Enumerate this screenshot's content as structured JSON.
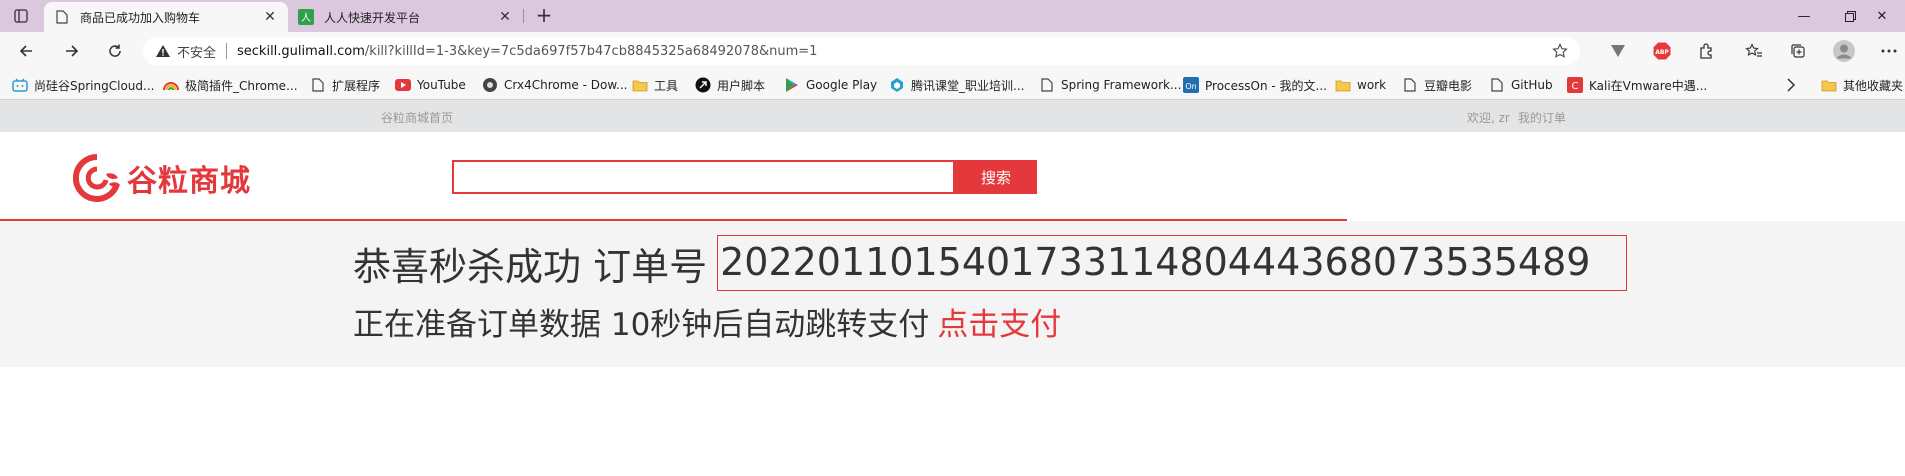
{
  "browser": {
    "tabs": [
      {
        "title": "商品已成功加入购物车",
        "active": true
      },
      {
        "title": "人人快速开发平台",
        "active": false
      }
    ],
    "new_tab": "+",
    "address": {
      "security_label": "不安全",
      "host": "seckill.gulimall.com",
      "path": "/kill?killId=1-3&key=7c5da697f57b47cb8845325a68492078&num=1"
    },
    "bookmarks": [
      "尚硅谷SpringCloud...",
      "极简插件_Chrome...",
      "扩展程序",
      "YouTube",
      "Crx4Chrome - Dow...",
      "工具",
      "用户脚本",
      "Google Play",
      "腾讯课堂_职业培训...",
      "Spring Framework...",
      "ProcessOn - 我的文...",
      "work",
      "豆瓣电影",
      "GitHub",
      "Kali在Vmware中遇..."
    ],
    "other_bookmarks": "其他收藏夹",
    "abp_label": "ABP"
  },
  "site": {
    "topnav": {
      "home": "谷粒商城首页",
      "welcome": "欢迎, zr",
      "my_orders": "我的订单"
    },
    "logo_text": "谷粒商城",
    "search": {
      "placeholder": "",
      "button": "搜索"
    },
    "result": {
      "success_text": "恭喜秒杀成功 订单号",
      "order_number": "202201101540173311480444368073535489",
      "preparing_text": "正在准备订单数据 10秒钟后自动跳转支付",
      "pay_link": "点击支付"
    }
  },
  "colors": {
    "tabstrip": "#dbc7de",
    "brand_red": "#e4393c",
    "topnav_bg": "#e3e4e5",
    "content_bg": "#f4f4f4"
  }
}
